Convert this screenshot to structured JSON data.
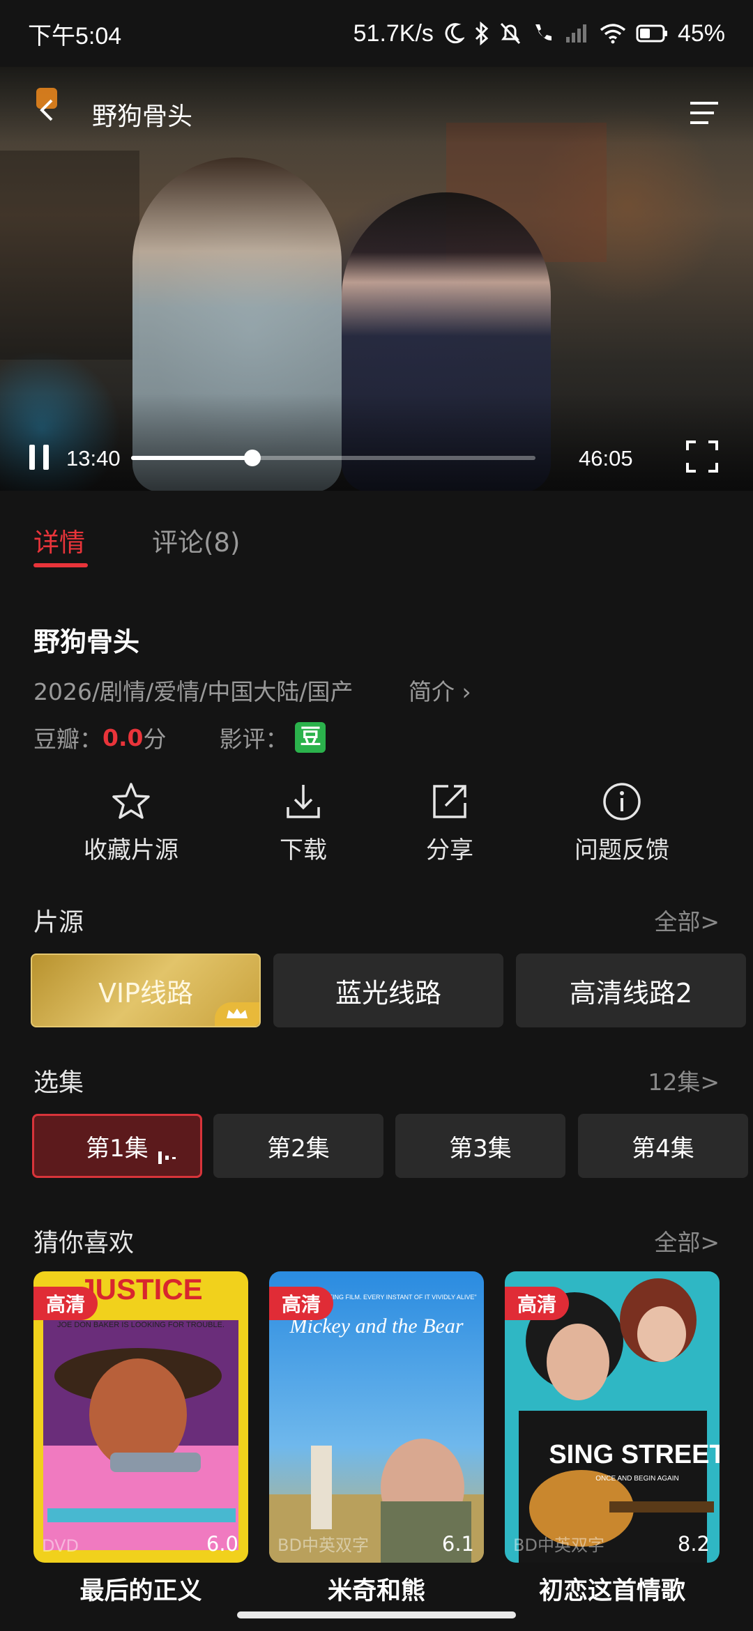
{
  "status_bar": {
    "time": "下午5:04",
    "network_speed": "51.7K/s",
    "battery": "45%"
  },
  "player": {
    "title": "野狗骨头",
    "current_time": "13:40",
    "duration": "46:05",
    "progress": 0.3
  },
  "tabs": [
    {
      "label": "详情",
      "active": true
    },
    {
      "label": "评论(8)",
      "active": false
    }
  ],
  "info": {
    "title": "野狗骨头",
    "meta": "2026/剧情/爱情/中国大陆/国产",
    "intro_link": "简介 ›",
    "douban_label": "豆瓣：",
    "douban_score": "0.0",
    "douban_unit": "分",
    "review_label": "影评：",
    "review_badge": "豆"
  },
  "actions": [
    {
      "label": "收藏片源",
      "icon": "star-icon"
    },
    {
      "label": "下载",
      "icon": "download-icon"
    },
    {
      "label": "分享",
      "icon": "share-icon"
    },
    {
      "label": "问题反馈",
      "icon": "info-icon"
    }
  ],
  "sources": {
    "title": "片源",
    "more": "全部>",
    "items": [
      "VIP线路",
      "蓝光线路",
      "高清线路2"
    ]
  },
  "episodes": {
    "title": "选集",
    "more": "12集>",
    "items": [
      "第1集",
      "第2集",
      "第3集",
      "第4集"
    ]
  },
  "recommendations": {
    "title": "猜你喜欢",
    "more": "全部>",
    "items": [
      {
        "title": "最后的正义",
        "badge": "高清",
        "tag": "DVD",
        "score": "6.0",
        "poster_text": "JUSTICE",
        "poster_sub": "JOE DON BAKER IS LOOKING FOR TROUBLE."
      },
      {
        "title": "米奇和熊",
        "badge": "高清",
        "tag": "BD中英双字",
        "score": "6.1",
        "poster_text": "Mickey and the Bear",
        "poster_sub": "\"A SHARP, AFFECTING FILM. EVERY INSTANT OF IT VIVIDLY ALIVE\""
      },
      {
        "title": "初恋这首情歌",
        "badge": "高清",
        "tag": "BD中英双字",
        "score": "8.2",
        "poster_text": "SING STREET",
        "poster_sub": "ONCE AND BEGIN AGAIN"
      }
    ]
  },
  "colors": {
    "accent": "#e9343a",
    "background": "#141414",
    "vip_gold": "#d4b14e",
    "douban_green": "#2bb24c"
  }
}
